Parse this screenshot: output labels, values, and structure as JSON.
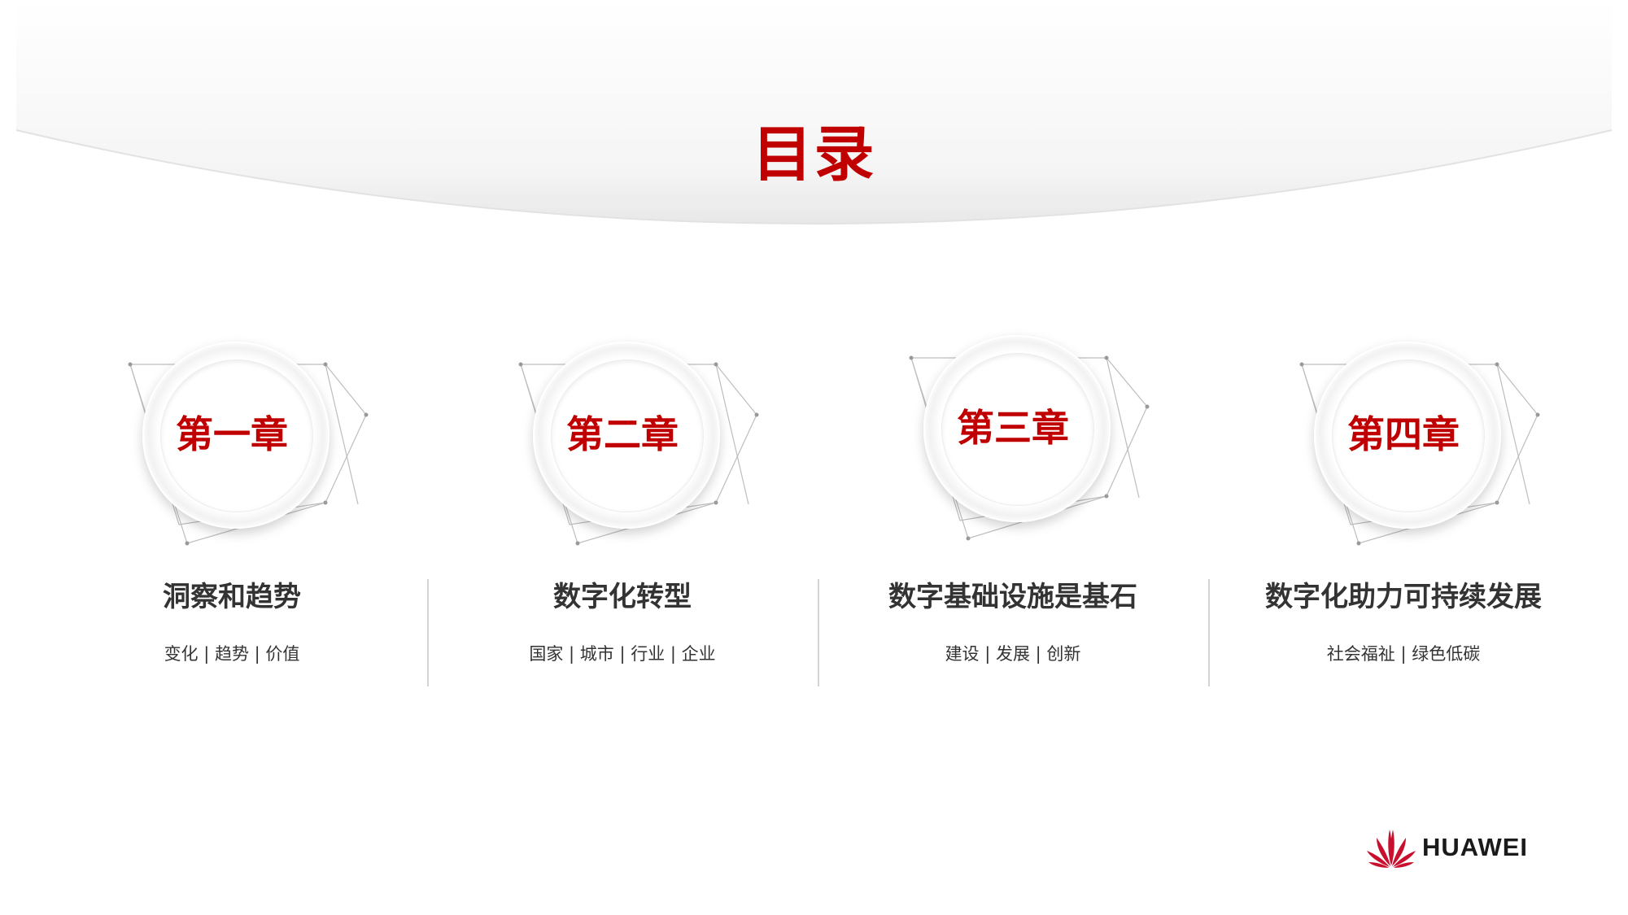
{
  "page": {
    "title": "目录"
  },
  "chapters": [
    {
      "label": "第一章",
      "title": "洞察和趋势",
      "subtitle": "变化 | 趋势 | 价值"
    },
    {
      "label": "第二章",
      "title": "数字化转型",
      "subtitle": "国家 | 城市 | 行业 | 企业"
    },
    {
      "label": "第三章",
      "title": "数字基础设施是基石",
      "subtitle": "建设 | 发展 | 创新"
    },
    {
      "label": "第四章",
      "title": "数字化助力可持续发展",
      "subtitle": "社会福祉 | 绿色低碳"
    }
  ],
  "brand": {
    "name": "HUAWEI",
    "color": "#c00000",
    "logo_icon": "huawei-petal-logo-icon"
  }
}
